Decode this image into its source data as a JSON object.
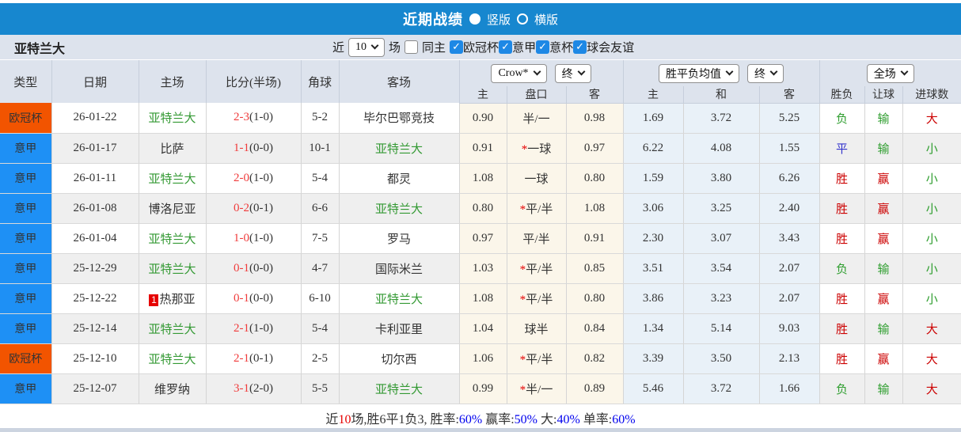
{
  "colors": {
    "topbar_bg": "#1787cf",
    "header_bg": "#dde3ed",
    "league": {
      "欧冠杯": "#f25400",
      "意甲": "#1e90f5"
    },
    "team_green": "#339933",
    "score_red": "#f03b3b",
    "win_red": "#cc0000",
    "lose_green": "#2f9e2f",
    "draw_blue": "#3333cc",
    "link_blue": "#0000ee",
    "odds_bg": "#fbf6ea",
    "avg_bg": "#e9f1f8",
    "checkbox_blue": "#1e88e5"
  },
  "topbar": {
    "title": "近期战绩",
    "radio_vertical": "竖版",
    "radio_horizontal": "横版",
    "selected": "竖版"
  },
  "filter": {
    "team": "亚特兰大",
    "near_label": "近",
    "count": "10",
    "unit": "场",
    "same_home_label": "同主",
    "same_home_checked": false,
    "leagues": [
      "欧冠杯",
      "意甲",
      "意杯",
      "球会友谊"
    ]
  },
  "header": {
    "cols": [
      "类型",
      "日期",
      "主场",
      "比分(半场)",
      "角球",
      "客场"
    ],
    "odds_select": "Crow*",
    "odds_final": "终",
    "odds_cols": [
      "主",
      "盘口",
      "客"
    ],
    "avg_select": "胜平负均值",
    "avg_final": "终",
    "avg_cols": [
      "主",
      "和",
      "客"
    ],
    "full_select": "全场",
    "result_cols": [
      "胜负",
      "让球",
      "进球数"
    ]
  },
  "rows": [
    {
      "type": "欧冠杯",
      "date": "26-01-22",
      "home": "亚特兰大",
      "home_green": true,
      "redcard": "",
      "score": "2-3",
      "half": "(1-0)",
      "corner": "5-2",
      "away": "毕尔巴鄂竞技",
      "away_green": false,
      "odds_home": "0.90",
      "star": "",
      "handicap": "半/一",
      "odds_away": "0.98",
      "avg_home": "1.69",
      "avg_draw": "3.72",
      "avg_away": "5.25",
      "result": "负",
      "result_c": "green",
      "lets": "输",
      "let_c": "green",
      "goals": "大",
      "goals_c": "red"
    },
    {
      "type": "意甲",
      "date": "26-01-17",
      "home": "比萨",
      "home_green": false,
      "redcard": "",
      "score": "1-1",
      "half": "(0-0)",
      "corner": "10-1",
      "away": "亚特兰大",
      "away_green": true,
      "odds_home": "0.91",
      "star": "*",
      "handicap": "一球",
      "odds_away": "0.97",
      "avg_home": "6.22",
      "avg_draw": "4.08",
      "avg_away": "1.55",
      "result": "平",
      "result_c": "blue",
      "lets": "输",
      "let_c": "green",
      "goals": "小",
      "goals_c": "green"
    },
    {
      "type": "意甲",
      "date": "26-01-11",
      "home": "亚特兰大",
      "home_green": true,
      "redcard": "",
      "score": "2-0",
      "half": "(1-0)",
      "corner": "5-4",
      "away": "都灵",
      "away_green": false,
      "odds_home": "1.08",
      "star": "",
      "handicap": "一球",
      "odds_away": "0.80",
      "avg_home": "1.59",
      "avg_draw": "3.80",
      "avg_away": "6.26",
      "result": "胜",
      "result_c": "red",
      "lets": "赢",
      "let_c": "red",
      "goals": "小",
      "goals_c": "green"
    },
    {
      "type": "意甲",
      "date": "26-01-08",
      "home": "博洛尼亚",
      "home_green": false,
      "redcard": "",
      "score": "0-2",
      "half": "(0-1)",
      "corner": "6-6",
      "away": "亚特兰大",
      "away_green": true,
      "odds_home": "0.80",
      "star": "*",
      "handicap": "平/半",
      "odds_away": "1.08",
      "avg_home": "3.06",
      "avg_draw": "3.25",
      "avg_away": "2.40",
      "result": "胜",
      "result_c": "red",
      "lets": "赢",
      "let_c": "red",
      "goals": "小",
      "goals_c": "green"
    },
    {
      "type": "意甲",
      "date": "26-01-04",
      "home": "亚特兰大",
      "home_green": true,
      "redcard": "",
      "score": "1-0",
      "half": "(1-0)",
      "corner": "7-5",
      "away": "罗马",
      "away_green": false,
      "odds_home": "0.97",
      "star": "",
      "handicap": "平/半",
      "odds_away": "0.91",
      "avg_home": "2.30",
      "avg_draw": "3.07",
      "avg_away": "3.43",
      "result": "胜",
      "result_c": "red",
      "lets": "赢",
      "let_c": "red",
      "goals": "小",
      "goals_c": "green"
    },
    {
      "type": "意甲",
      "date": "25-12-29",
      "home": "亚特兰大",
      "home_green": true,
      "redcard": "",
      "score": "0-1",
      "half": "(0-0)",
      "corner": "4-7",
      "away": "国际米兰",
      "away_green": false,
      "odds_home": "1.03",
      "star": "*",
      "handicap": "平/半",
      "odds_away": "0.85",
      "avg_home": "3.51",
      "avg_draw": "3.54",
      "avg_away": "2.07",
      "result": "负",
      "result_c": "green",
      "lets": "输",
      "let_c": "green",
      "goals": "小",
      "goals_c": "green"
    },
    {
      "type": "意甲",
      "date": "25-12-22",
      "home": "热那亚",
      "home_green": false,
      "redcard": "1",
      "score": "0-1",
      "half": "(0-0)",
      "corner": "6-10",
      "away": "亚特兰大",
      "away_green": true,
      "odds_home": "1.08",
      "star": "*",
      "handicap": "平/半",
      "odds_away": "0.80",
      "avg_home": "3.86",
      "avg_draw": "3.23",
      "avg_away": "2.07",
      "result": "胜",
      "result_c": "red",
      "lets": "赢",
      "let_c": "red",
      "goals": "小",
      "goals_c": "green"
    },
    {
      "type": "意甲",
      "date": "25-12-14",
      "home": "亚特兰大",
      "home_green": true,
      "redcard": "",
      "score": "2-1",
      "half": "(1-0)",
      "corner": "5-4",
      "away": "卡利亚里",
      "away_green": false,
      "odds_home": "1.04",
      "star": "",
      "handicap": "球半",
      "odds_away": "0.84",
      "avg_home": "1.34",
      "avg_draw": "5.14",
      "avg_away": "9.03",
      "result": "胜",
      "result_c": "red",
      "lets": "输",
      "let_c": "green",
      "goals": "大",
      "goals_c": "red"
    },
    {
      "type": "欧冠杯",
      "date": "25-12-10",
      "home": "亚特兰大",
      "home_green": true,
      "redcard": "",
      "score": "2-1",
      "half": "(0-1)",
      "corner": "2-5",
      "away": "切尔西",
      "away_green": false,
      "odds_home": "1.06",
      "star": "*",
      "handicap": "平/半",
      "odds_away": "0.82",
      "avg_home": "3.39",
      "avg_draw": "3.50",
      "avg_away": "2.13",
      "result": "胜",
      "result_c": "red",
      "lets": "赢",
      "let_c": "red",
      "goals": "大",
      "goals_c": "red"
    },
    {
      "type": "意甲",
      "date": "25-12-07",
      "home": "维罗纳",
      "home_green": false,
      "redcard": "",
      "score": "3-1",
      "half": "(2-0)",
      "corner": "5-5",
      "away": "亚特兰大",
      "away_green": true,
      "odds_home": "0.99",
      "star": "*",
      "handicap": "半/一",
      "odds_away": "0.89",
      "avg_home": "5.46",
      "avg_draw": "3.72",
      "avg_away": "1.66",
      "result": "负",
      "result_c": "green",
      "lets": "输",
      "let_c": "green",
      "goals": "大",
      "goals_c": "red"
    }
  ],
  "footer": {
    "parts": [
      {
        "t": "近",
        "c": "dark"
      },
      {
        "t": "10",
        "c": "red"
      },
      {
        "t": "场,胜6平1负3, 胜率:",
        "c": "dark"
      },
      {
        "t": "60%",
        "c": "blue"
      },
      {
        "t": " 赢率:",
        "c": "dark"
      },
      {
        "t": "50%",
        "c": "blue"
      },
      {
        "t": " 大:",
        "c": "dark"
      },
      {
        "t": "40%",
        "c": "blue"
      },
      {
        "t": " 单率:",
        "c": "dark"
      },
      {
        "t": "60%",
        "c": "blue"
      }
    ]
  }
}
